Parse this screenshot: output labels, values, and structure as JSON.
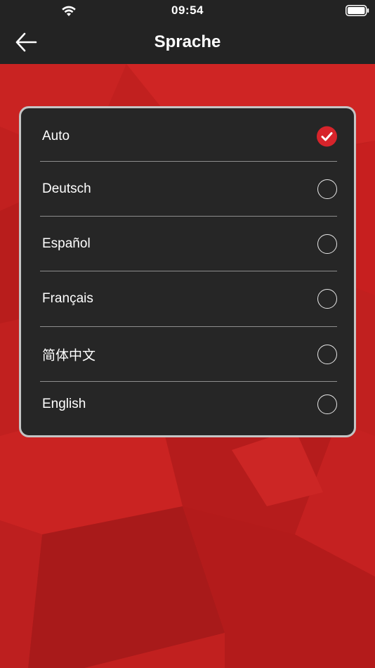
{
  "status_bar": {
    "time": "09:54"
  },
  "nav": {
    "title": "Sprache",
    "back_icon": "arrow-left-icon"
  },
  "languages": {
    "selected_index": 0,
    "items": [
      {
        "label": "Auto",
        "selected": true
      },
      {
        "label": "Deutsch",
        "selected": false
      },
      {
        "label": "Español",
        "selected": false
      },
      {
        "label": "Français",
        "selected": false
      },
      {
        "label": "简体中文",
        "selected": false
      },
      {
        "label": "English",
        "selected": false
      }
    ]
  },
  "colors": {
    "header": "#232323",
    "background": "#c1201f",
    "card": "#262626",
    "card_border": "#c4c4c4",
    "accent": "#d7242b"
  }
}
